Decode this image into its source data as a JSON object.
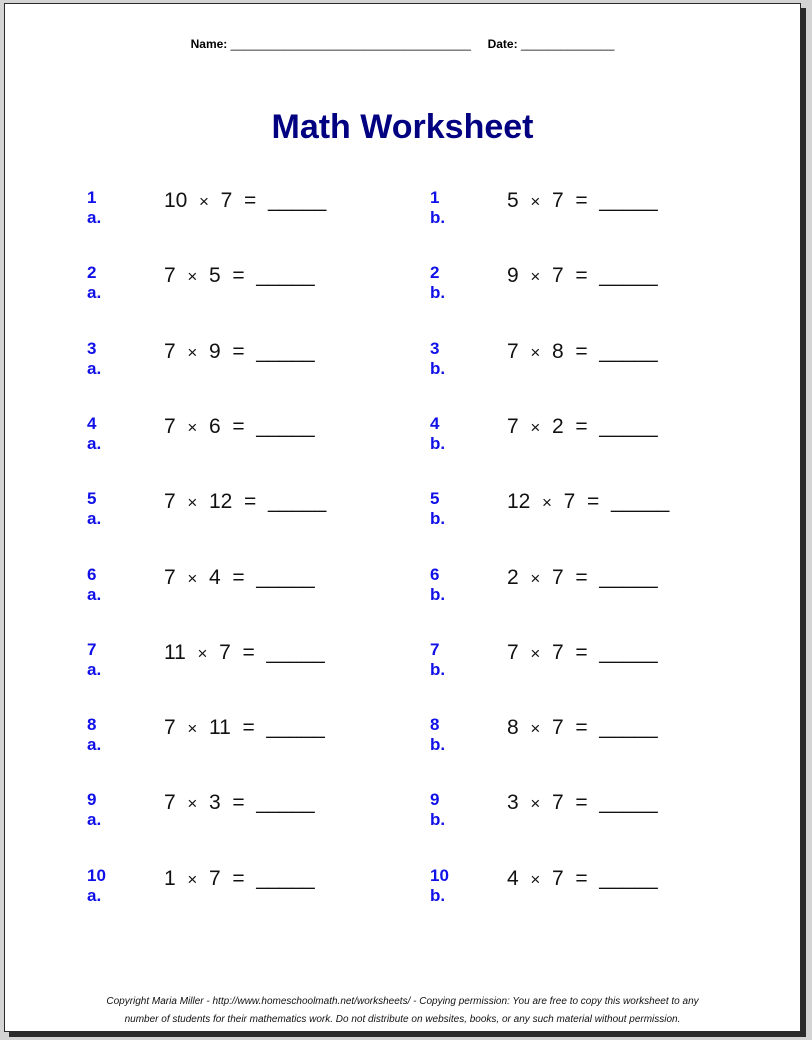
{
  "header": {
    "name_label": "Name:",
    "name_blank": "____________________________________",
    "date_label": "Date:",
    "date_blank": "______________"
  },
  "title": "Math Worksheet",
  "colors": {
    "title": "#000080",
    "label": "#1010e8",
    "text": "#111111",
    "background": "#d4d4d4"
  },
  "problems": {
    "a": [
      {
        "label": "1 a.",
        "x": "10",
        "op": "×",
        "y": "7",
        "eq": "=",
        "blank": "_____"
      },
      {
        "label": "2 a.",
        "x": "7",
        "op": "×",
        "y": "5",
        "eq": "=",
        "blank": "_____"
      },
      {
        "label": "3 a.",
        "x": "7",
        "op": "×",
        "y": "9",
        "eq": "=",
        "blank": "_____"
      },
      {
        "label": "4 a.",
        "x": "7",
        "op": "×",
        "y": "6",
        "eq": "=",
        "blank": "_____"
      },
      {
        "label": "5 a.",
        "x": "7",
        "op": "×",
        "y": "12",
        "eq": "=",
        "blank": "_____"
      },
      {
        "label": "6 a.",
        "x": "7",
        "op": "×",
        "y": "4",
        "eq": "=",
        "blank": "_____"
      },
      {
        "label": "7 a.",
        "x": "11",
        "op": "×",
        "y": "7",
        "eq": "=",
        "blank": "_____"
      },
      {
        "label": "8 a.",
        "x": "7",
        "op": "×",
        "y": "11",
        "eq": "=",
        "blank": "_____"
      },
      {
        "label": "9 a.",
        "x": "7",
        "op": "×",
        "y": "3",
        "eq": "=",
        "blank": "_____"
      },
      {
        "label": "10 a.",
        "x": "1",
        "op": "×",
        "y": "7",
        "eq": "=",
        "blank": "_____"
      }
    ],
    "b": [
      {
        "label": "1 b.",
        "x": "5",
        "op": "×",
        "y": "7",
        "eq": "=",
        "blank": "_____"
      },
      {
        "label": "2 b.",
        "x": "9",
        "op": "×",
        "y": "7",
        "eq": "=",
        "blank": "_____"
      },
      {
        "label": "3 b.",
        "x": "7",
        "op": "×",
        "y": "8",
        "eq": "=",
        "blank": "_____"
      },
      {
        "label": "4 b.",
        "x": "7",
        "op": "×",
        "y": "2",
        "eq": "=",
        "blank": "_____"
      },
      {
        "label": "5 b.",
        "x": "12",
        "op": "×",
        "y": "7",
        "eq": "=",
        "blank": "_____"
      },
      {
        "label": "6 b.",
        "x": "2",
        "op": "×",
        "y": "7",
        "eq": "=",
        "blank": "_____"
      },
      {
        "label": "7 b.",
        "x": "7",
        "op": "×",
        "y": "7",
        "eq": "=",
        "blank": "_____"
      },
      {
        "label": "8 b.",
        "x": "8",
        "op": "×",
        "y": "7",
        "eq": "=",
        "blank": "_____"
      },
      {
        "label": "9 b.",
        "x": "3",
        "op": "×",
        "y": "7",
        "eq": "=",
        "blank": "_____"
      },
      {
        "label": "10 b.",
        "x": "4",
        "op": "×",
        "y": "7",
        "eq": "=",
        "blank": "_____"
      }
    ]
  },
  "footer": {
    "line1": "Copyright Maria Miller - http://www.homeschoolmath.net/worksheets/ - Copying permission: You are free to copy this worksheet to any",
    "line2": "number of students for their mathematics work. Do not distribute on websites, books, or any such material without permission."
  }
}
